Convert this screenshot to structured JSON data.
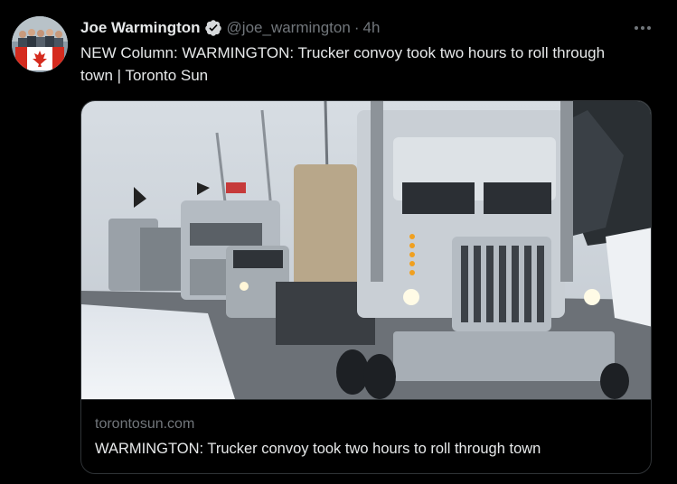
{
  "tweet": {
    "author_name": "Joe Warmington",
    "handle": "@joe_warmington",
    "separator": "·",
    "time": "4h",
    "text": "NEW Column: WARMINGTON: Trucker convoy took two hours to roll through town | Toronto Sun"
  },
  "card": {
    "domain": "torontosun.com",
    "title": "WARMINGTON: Trucker convoy took two hours to roll through town"
  },
  "icons": {
    "verified": "verified-badge-icon",
    "more": "more-options-icon",
    "flag": "canada-flag"
  },
  "colors": {
    "background": "#000000",
    "text_primary": "#e7e9ea",
    "text_secondary": "#71767b",
    "border": "#2f3336"
  }
}
